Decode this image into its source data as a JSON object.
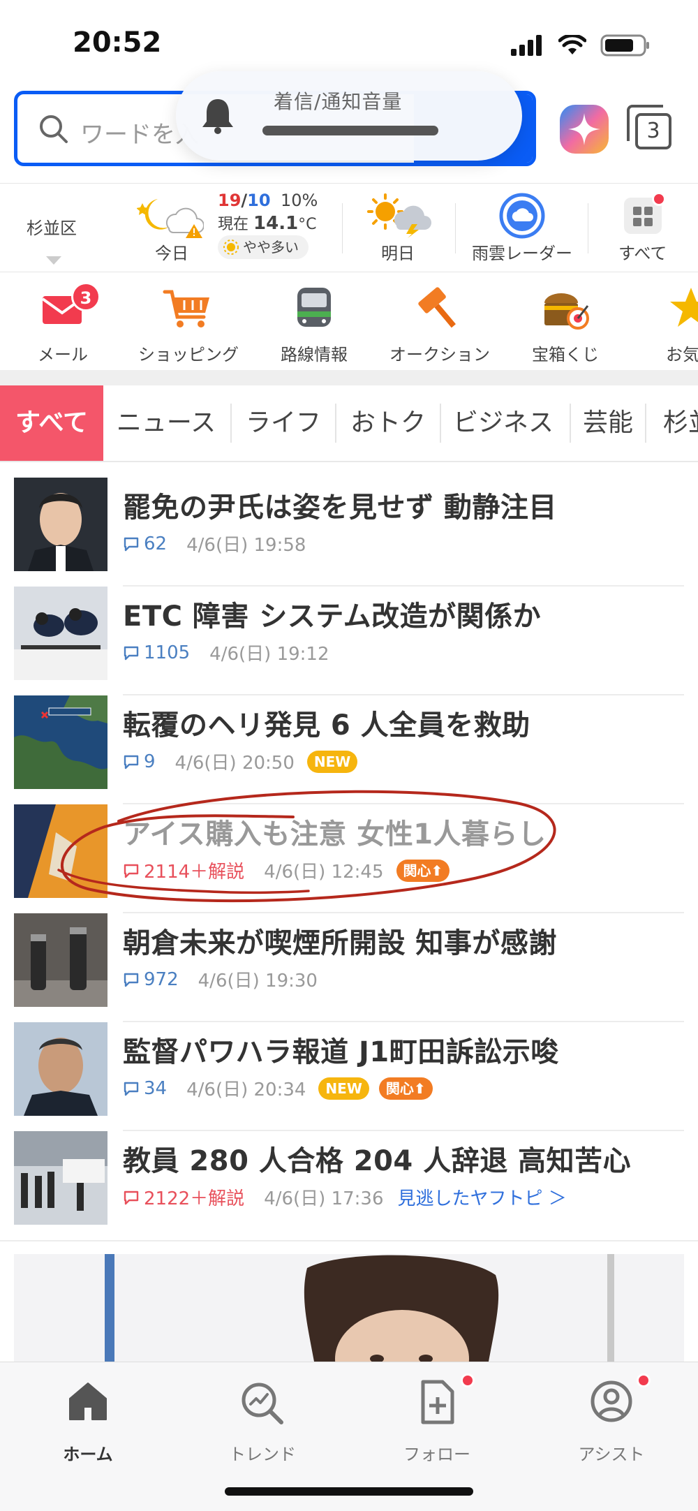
{
  "status_bar": {
    "time": "20:52"
  },
  "search": {
    "placeholder": "ワードを入",
    "volume_popup_title": "着信/通知音量"
  },
  "tabs_count": "3",
  "weather": {
    "area": "杉並区",
    "today_label": "今日",
    "temp_high": "19",
    "temp_sep": "/",
    "temp_low": "10",
    "precip": "10%",
    "now_prefix": "現在",
    "now_temp": "14.1",
    "now_unit": "°C",
    "pollen": "やや多い",
    "tomorrow_label": "明日",
    "radar_label": "雨雲レーダー",
    "all_label": "すべて"
  },
  "services": [
    {
      "label": "メール",
      "icon": "mail-icon",
      "badge": "3"
    },
    {
      "label": "ショッピング",
      "icon": "shopping-cart-icon"
    },
    {
      "label": "路線情報",
      "icon": "train-icon"
    },
    {
      "label": "オークション",
      "icon": "auction-hammer-icon"
    },
    {
      "label": "宝箱くじ",
      "icon": "treasure-box-icon"
    },
    {
      "label": "お気に",
      "icon": "star-icon"
    }
  ],
  "category_tabs": [
    "すべて",
    "ニュース",
    "ライフ",
    "おトク",
    "ビジネス",
    "芸能",
    "杉並"
  ],
  "news": [
    {
      "title": "罷免の尹氏は姿を見せず 動静注目",
      "comments": "62",
      "date": "4/6(日) 19:58"
    },
    {
      "title": "ETC 障害 システム改造が関係か",
      "comments": "1105",
      "date": "4/6(日) 19:12"
    },
    {
      "title": "転覆のヘリ発見 6 人全員を救助",
      "comments": "9",
      "date": "4/6(日) 20:50",
      "badge": "NEW"
    },
    {
      "title": "アイス購入も注意 女性1人暮らし",
      "comments": "2114＋解説",
      "date": "4/6(日) 12:45",
      "badge": "関心⬆",
      "read": true
    },
    {
      "title": "朝倉未来が喫煙所開設 知事が感謝",
      "comments": "972",
      "date": "4/6(日) 19:30"
    },
    {
      "title": "監督パワハラ報道 J1町田訴訟示唆",
      "comments": "34",
      "date": "4/6(日) 20:34",
      "badge": "NEW",
      "badge2": "関心⬆"
    },
    {
      "title": "教員 280 人合格 204 人辞退 高知苦心",
      "comments": "2122＋解説",
      "date": "4/6(日) 17:36",
      "link": "見逃したヤフトピ ＞"
    }
  ],
  "bottom_nav": [
    {
      "label": "ホーム",
      "icon": "home-icon",
      "active": true
    },
    {
      "label": "トレンド",
      "icon": "trend-icon"
    },
    {
      "label": "フォロー",
      "icon": "follow-icon"
    },
    {
      "label": "アシスト",
      "icon": "assist-icon"
    }
  ],
  "colors": {
    "accent": "#0a5cf5",
    "category_active": "#f4566a",
    "badge_red": "#f23b4e",
    "new_badge": "#f6b50e",
    "kanshin_badge": "#f27c23",
    "annotation": "#b5281c"
  }
}
